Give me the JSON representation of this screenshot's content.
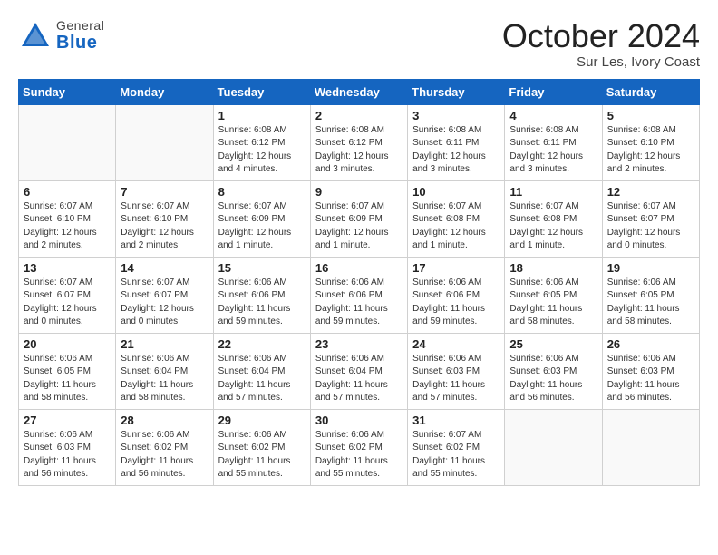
{
  "header": {
    "logo_line1": "General",
    "logo_line2": "Blue",
    "month": "October 2024",
    "location": "Sur Les, Ivory Coast"
  },
  "weekdays": [
    "Sunday",
    "Monday",
    "Tuesday",
    "Wednesday",
    "Thursday",
    "Friday",
    "Saturday"
  ],
  "weeks": [
    [
      {
        "day": "",
        "info": ""
      },
      {
        "day": "",
        "info": ""
      },
      {
        "day": "1",
        "info": "Sunrise: 6:08 AM\nSunset: 6:12 PM\nDaylight: 12 hours\nand 4 minutes."
      },
      {
        "day": "2",
        "info": "Sunrise: 6:08 AM\nSunset: 6:12 PM\nDaylight: 12 hours\nand 3 minutes."
      },
      {
        "day": "3",
        "info": "Sunrise: 6:08 AM\nSunset: 6:11 PM\nDaylight: 12 hours\nand 3 minutes."
      },
      {
        "day": "4",
        "info": "Sunrise: 6:08 AM\nSunset: 6:11 PM\nDaylight: 12 hours\nand 3 minutes."
      },
      {
        "day": "5",
        "info": "Sunrise: 6:08 AM\nSunset: 6:10 PM\nDaylight: 12 hours\nand 2 minutes."
      }
    ],
    [
      {
        "day": "6",
        "info": "Sunrise: 6:07 AM\nSunset: 6:10 PM\nDaylight: 12 hours\nand 2 minutes."
      },
      {
        "day": "7",
        "info": "Sunrise: 6:07 AM\nSunset: 6:10 PM\nDaylight: 12 hours\nand 2 minutes."
      },
      {
        "day": "8",
        "info": "Sunrise: 6:07 AM\nSunset: 6:09 PM\nDaylight: 12 hours\nand 1 minute."
      },
      {
        "day": "9",
        "info": "Sunrise: 6:07 AM\nSunset: 6:09 PM\nDaylight: 12 hours\nand 1 minute."
      },
      {
        "day": "10",
        "info": "Sunrise: 6:07 AM\nSunset: 6:08 PM\nDaylight: 12 hours\nand 1 minute."
      },
      {
        "day": "11",
        "info": "Sunrise: 6:07 AM\nSunset: 6:08 PM\nDaylight: 12 hours\nand 1 minute."
      },
      {
        "day": "12",
        "info": "Sunrise: 6:07 AM\nSunset: 6:07 PM\nDaylight: 12 hours\nand 0 minutes."
      }
    ],
    [
      {
        "day": "13",
        "info": "Sunrise: 6:07 AM\nSunset: 6:07 PM\nDaylight: 12 hours\nand 0 minutes."
      },
      {
        "day": "14",
        "info": "Sunrise: 6:07 AM\nSunset: 6:07 PM\nDaylight: 12 hours\nand 0 minutes."
      },
      {
        "day": "15",
        "info": "Sunrise: 6:06 AM\nSunset: 6:06 PM\nDaylight: 11 hours\nand 59 minutes."
      },
      {
        "day": "16",
        "info": "Sunrise: 6:06 AM\nSunset: 6:06 PM\nDaylight: 11 hours\nand 59 minutes."
      },
      {
        "day": "17",
        "info": "Sunrise: 6:06 AM\nSunset: 6:06 PM\nDaylight: 11 hours\nand 59 minutes."
      },
      {
        "day": "18",
        "info": "Sunrise: 6:06 AM\nSunset: 6:05 PM\nDaylight: 11 hours\nand 58 minutes."
      },
      {
        "day": "19",
        "info": "Sunrise: 6:06 AM\nSunset: 6:05 PM\nDaylight: 11 hours\nand 58 minutes."
      }
    ],
    [
      {
        "day": "20",
        "info": "Sunrise: 6:06 AM\nSunset: 6:05 PM\nDaylight: 11 hours\nand 58 minutes."
      },
      {
        "day": "21",
        "info": "Sunrise: 6:06 AM\nSunset: 6:04 PM\nDaylight: 11 hours\nand 58 minutes."
      },
      {
        "day": "22",
        "info": "Sunrise: 6:06 AM\nSunset: 6:04 PM\nDaylight: 11 hours\nand 57 minutes."
      },
      {
        "day": "23",
        "info": "Sunrise: 6:06 AM\nSunset: 6:04 PM\nDaylight: 11 hours\nand 57 minutes."
      },
      {
        "day": "24",
        "info": "Sunrise: 6:06 AM\nSunset: 6:03 PM\nDaylight: 11 hours\nand 57 minutes."
      },
      {
        "day": "25",
        "info": "Sunrise: 6:06 AM\nSunset: 6:03 PM\nDaylight: 11 hours\nand 56 minutes."
      },
      {
        "day": "26",
        "info": "Sunrise: 6:06 AM\nSunset: 6:03 PM\nDaylight: 11 hours\nand 56 minutes."
      }
    ],
    [
      {
        "day": "27",
        "info": "Sunrise: 6:06 AM\nSunset: 6:03 PM\nDaylight: 11 hours\nand 56 minutes."
      },
      {
        "day": "28",
        "info": "Sunrise: 6:06 AM\nSunset: 6:02 PM\nDaylight: 11 hours\nand 56 minutes."
      },
      {
        "day": "29",
        "info": "Sunrise: 6:06 AM\nSunset: 6:02 PM\nDaylight: 11 hours\nand 55 minutes."
      },
      {
        "day": "30",
        "info": "Sunrise: 6:06 AM\nSunset: 6:02 PM\nDaylight: 11 hours\nand 55 minutes."
      },
      {
        "day": "31",
        "info": "Sunrise: 6:07 AM\nSunset: 6:02 PM\nDaylight: 11 hours\nand 55 minutes."
      },
      {
        "day": "",
        "info": ""
      },
      {
        "day": "",
        "info": ""
      }
    ]
  ]
}
